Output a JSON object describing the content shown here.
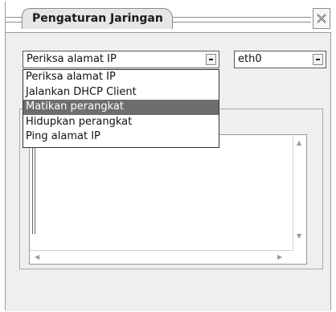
{
  "window": {
    "title": "Pengaturan Jaringan"
  },
  "action_select": {
    "value": "Periksa alamat IP",
    "options": [
      "Periksa alamat IP",
      "Jalankan DHCP Client",
      "Matikan perangkat",
      "Hidupkan perangkat",
      "Ping alamat IP"
    ],
    "highlighted_index": 2
  },
  "interface_select": {
    "value": "eth0"
  },
  "colors": {
    "highlight": "#6e6e6e",
    "window_bg": "#efefef"
  }
}
